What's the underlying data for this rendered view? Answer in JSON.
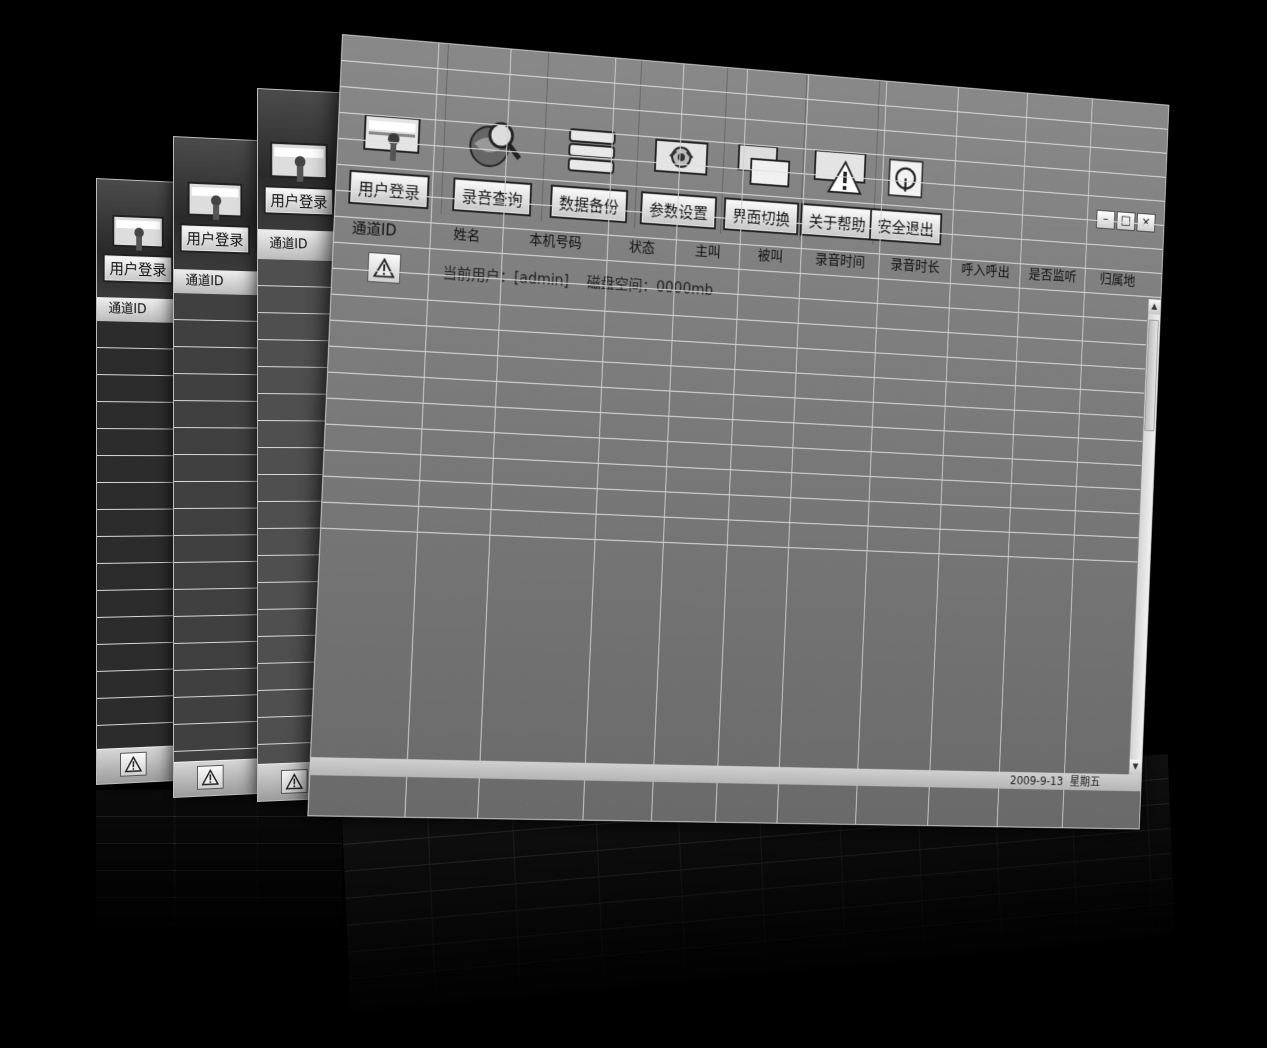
{
  "toolbar": {
    "items": [
      {
        "label": "用户登录",
        "icon": "user-login-icon"
      },
      {
        "label": "录音查询",
        "icon": "recording-search-icon"
      },
      {
        "label": "数据备份",
        "icon": "database-backup-icon"
      },
      {
        "label": "参数设置",
        "icon": "settings-icon"
      },
      {
        "label": "界面切换",
        "icon": "switch-view-icon"
      },
      {
        "label": "关于帮助",
        "icon": "help-warning-icon"
      },
      {
        "label": "安全退出",
        "icon": "power-icon"
      }
    ]
  },
  "window_controls": {
    "minimize": "–",
    "maximize": "□",
    "close": "×"
  },
  "table": {
    "columns": [
      "通道ID",
      "姓名",
      "本机号码",
      "状态",
      "主叫",
      "被叫",
      "录音时间",
      "录音时长",
      "呼入呼出",
      "是否监听",
      "归属地"
    ]
  },
  "date_text": "2009-9-13  星期五",
  "status": {
    "text": "当前用户：[admin]    磁盘空间：0000mb"
  },
  "back_windows": {
    "tool_label": "用户登录",
    "first_column": "通道ID",
    "truncated_label": "用户登录"
  },
  "colors": {
    "background": "#000000",
    "grid": "#5e5e5e",
    "header": "#d8d8d8"
  }
}
